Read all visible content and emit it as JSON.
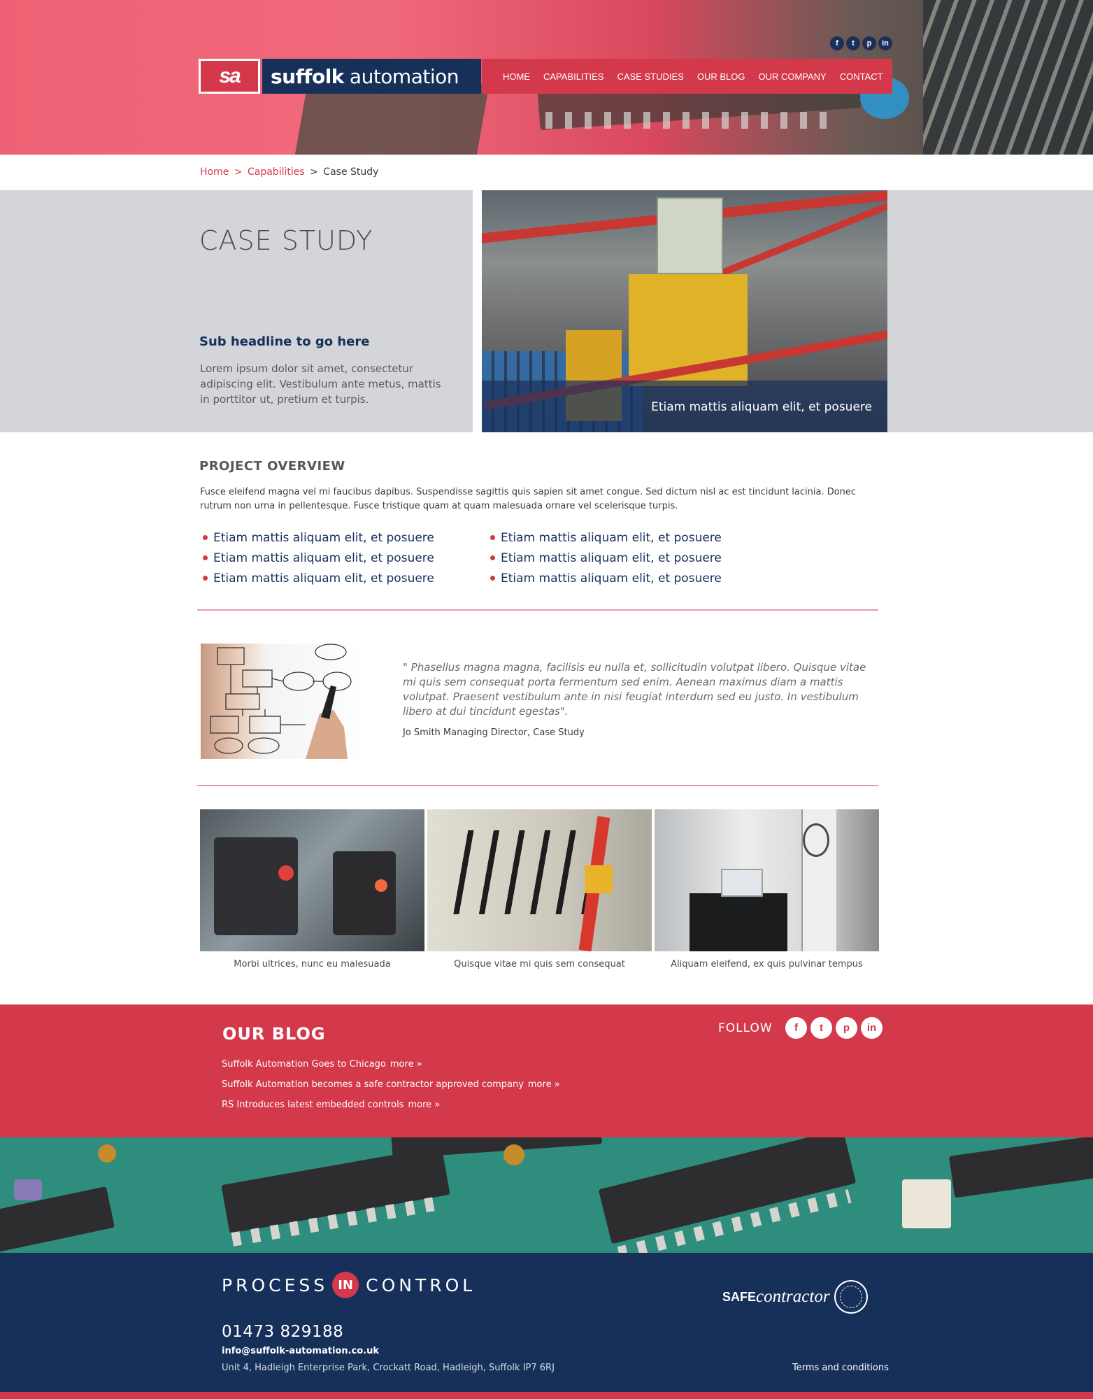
{
  "brand": {
    "logo_mark": "sa",
    "name_bold": "suffolk",
    "name_light": "automation",
    "colors": {
      "red": "#d4394b",
      "navy": "#16305a",
      "grey_panel": "#d4d5d9"
    }
  },
  "header_social": [
    {
      "icon": "facebook-icon",
      "glyph": "f"
    },
    {
      "icon": "twitter-icon",
      "glyph": "t"
    },
    {
      "icon": "pinterest-icon",
      "glyph": "p"
    },
    {
      "icon": "linkedin-icon",
      "glyph": "in"
    }
  ],
  "nav": {
    "items": [
      "HOME",
      "CAPABILITIES",
      "CASE STUDIES",
      "OUR BLOG",
      "OUR COMPANY",
      "CONTACT"
    ]
  },
  "breadcrumb": {
    "home": "Home",
    "capabilities": "Capabilities",
    "separator": ">",
    "current": "Case Study"
  },
  "intro": {
    "title": "CASE STUDY",
    "sub_headline": "Sub headline to go here",
    "text": "Lorem ipsum dolor sit amet, consectetur adipiscing elit. Vestibulum ante metus, mattis in porttitor ut, pretium et turpis.",
    "image_caption": "Etiam mattis aliquam elit, et posuere"
  },
  "overview": {
    "title": "PROJECT OVERVIEW",
    "text": "Fusce eleifend magna vel mi faucibus dapibus. Suspendisse sagittis quis sapien sit amet congue. Sed dictum nisl ac est tincidunt lacinia. Donec rutrum non urna in pellentesque. Fusce tristique quam at quam malesuada ornare vel scelerisque turpis.",
    "bullets_col1": [
      "Etiam mattis aliquam elit, et posuere",
      "Etiam mattis aliquam elit, et posuere",
      "Etiam mattis aliquam elit, et posuere"
    ],
    "bullets_col2": [
      "Etiam mattis aliquam elit, et posuere",
      "Etiam mattis aliquam elit, et posuere",
      "Etiam mattis aliquam elit, et posuere"
    ]
  },
  "testimonial": {
    "quote": "\" Phasellus magna magna, facilisis eu nulla et, sollicitudin volutpat libero. Quisque vitae mi quis sem consequat porta fermentum sed enim. Aenean maximus diam a mattis volutpat. Praesent vestibulum ante in nisi feugiat interdum sed eu justo. In vestibulum libero at dui tincidunt egestas\".",
    "author": "Jo Smith  Managing Director, Case Study"
  },
  "gallery": [
    {
      "caption": "Morbi ultrices, nunc eu malesuada"
    },
    {
      "caption": "Quisque vitae mi quis sem consequat"
    },
    {
      "caption": "Aliquam eleifend, ex quis pulvinar tempus"
    }
  ],
  "blog": {
    "title": "OUR BLOG",
    "follow_label": "FOLLOW",
    "more_label": "more »",
    "posts": [
      "Suffolk Automation Goes to Chicago",
      "Suffolk Automation becomes a safe contractor approved company",
      "RS Introduces latest embedded controls"
    ]
  },
  "footer_social": [
    {
      "icon": "facebook-icon",
      "glyph": "f"
    },
    {
      "icon": "twitter-icon",
      "glyph": "t"
    },
    {
      "icon": "pinterest-icon",
      "glyph": "p"
    },
    {
      "icon": "linkedin-icon",
      "glyph": "in"
    }
  ],
  "footer": {
    "pic_left": "PROCESS",
    "pic_mid": "IN",
    "pic_right": "CONTROL",
    "safe_bold": "SAFE",
    "safe_italic": "contractor",
    "phone": "01473 829188",
    "email": "info@suffolk-automation.co.uk",
    "address": "Unit 4, Hadleigh Enterprise Park, Crockatt Road, Hadleigh,  Suffolk IP7 6RJ",
    "terms": "Terms and conditions"
  }
}
